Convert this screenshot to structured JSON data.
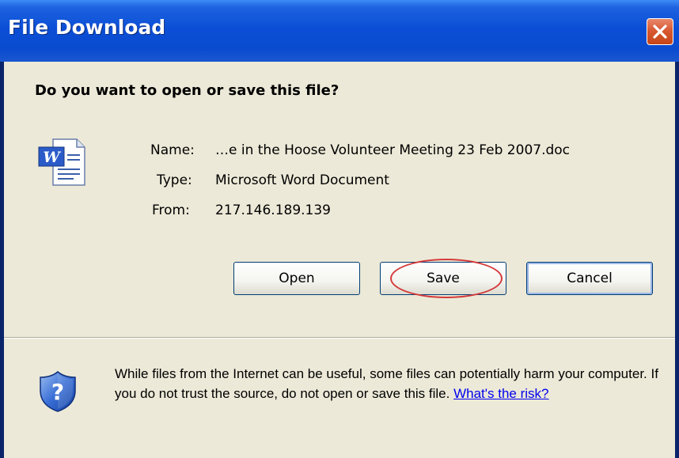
{
  "window": {
    "title": "File Download"
  },
  "dialog": {
    "question": "Do you want to open or save this file?",
    "file": {
      "name_label": "Name:",
      "name_value": "…e in the Hoose Volunteer Meeting 23 Feb 2007.doc",
      "type_label": "Type:",
      "type_value": "Microsoft Word Document",
      "from_label": "From:",
      "from_value": "217.146.189.139"
    },
    "buttons": {
      "open": "Open",
      "save": "Save",
      "cancel": "Cancel"
    },
    "warning": {
      "text": "While files from the Internet can be useful, some files can potentially harm your computer. If you do not trust the source, do not open or save this file. ",
      "link": "What's the risk?"
    }
  },
  "icons": {
    "file": "word-document-icon",
    "warning": "security-shield-icon",
    "close": "close-icon"
  },
  "colors": {
    "titlebar": "#0b4fd6",
    "dialog_background": "#ece9d8",
    "close_button": "#d85a32",
    "annotation": "#d43a3a",
    "link": "#0000ee"
  }
}
